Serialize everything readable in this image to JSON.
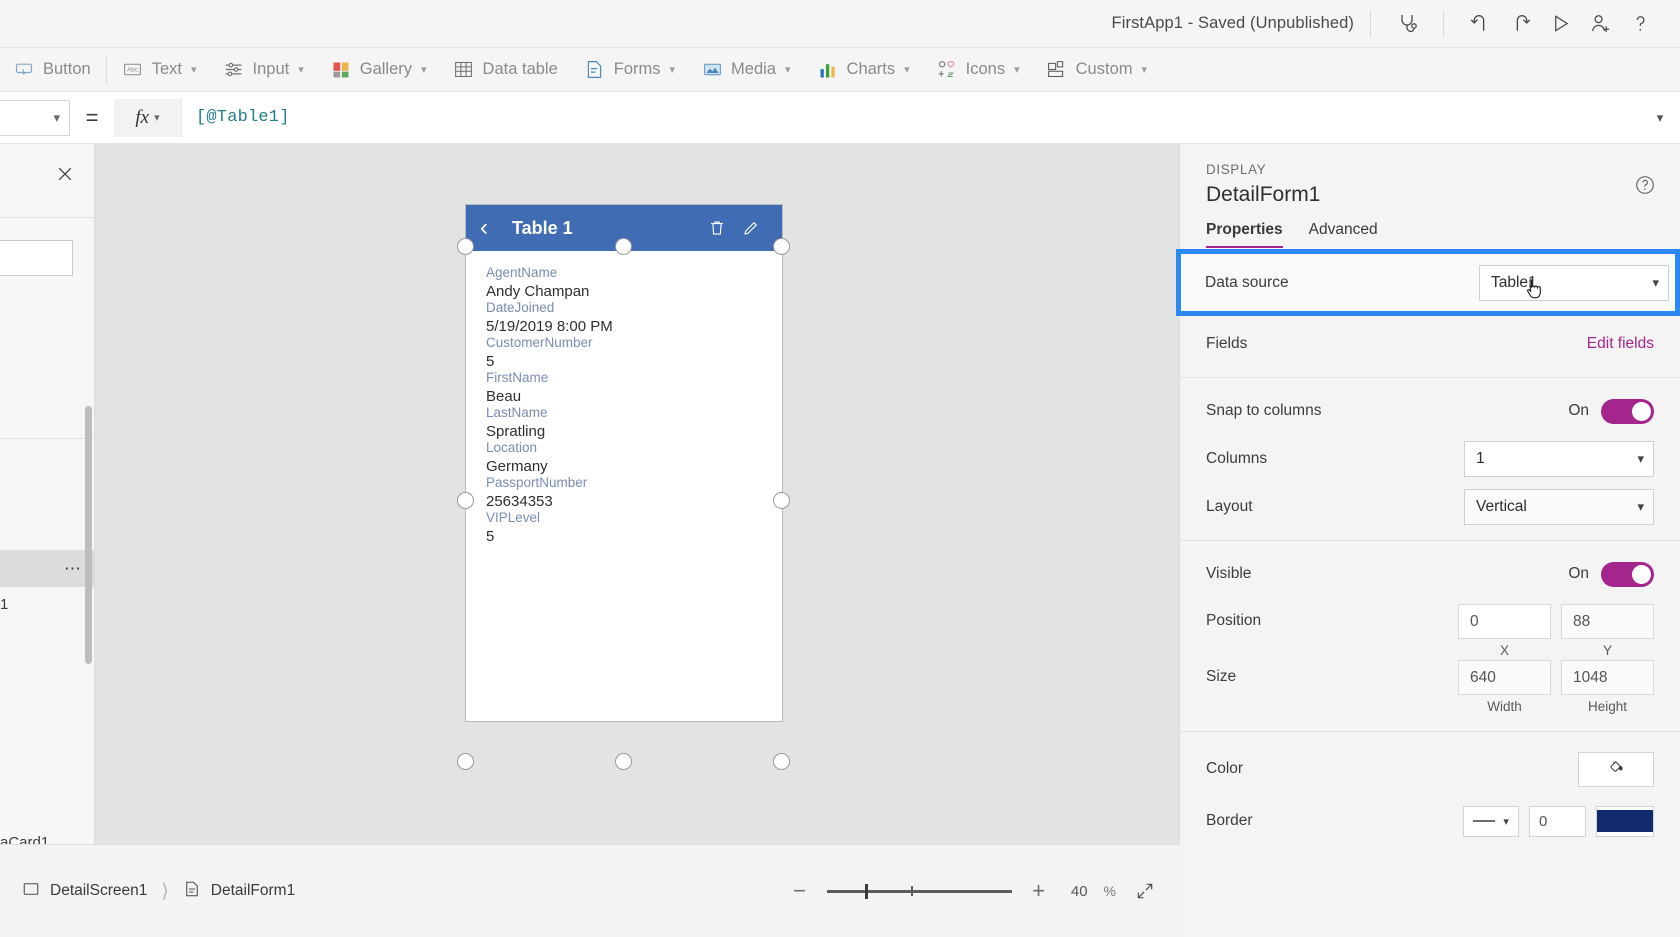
{
  "topbar": {
    "app_title": "FirstApp1 - Saved (Unpublished)",
    "icons": [
      {
        "name": "app-checker-icon",
        "glyph": "stethoscope"
      },
      {
        "name": "undo-icon",
        "glyph": "undo"
      },
      {
        "name": "redo-icon",
        "glyph": "redo"
      },
      {
        "name": "preview-app-icon",
        "glyph": "play"
      },
      {
        "name": "share-icon",
        "glyph": "person-add"
      },
      {
        "name": "help-icon",
        "glyph": "question"
      }
    ]
  },
  "ribbon": {
    "items": [
      {
        "label": "Button",
        "icon": "button-icon",
        "caret": false
      },
      {
        "label": "Text",
        "icon": "text-icon",
        "caret": true
      },
      {
        "label": "Input",
        "icon": "input-icon",
        "caret": true
      },
      {
        "label": "Gallery",
        "icon": "gallery-icon",
        "caret": true
      },
      {
        "label": "Data table",
        "icon": "data-table-icon",
        "caret": false
      },
      {
        "label": "Forms",
        "icon": "forms-icon",
        "caret": true
      },
      {
        "label": "Media",
        "icon": "media-icon",
        "caret": true
      },
      {
        "label": "Charts",
        "icon": "charts-icon",
        "caret": true
      },
      {
        "label": "Icons",
        "icon": "icons-icon",
        "caret": true
      },
      {
        "label": "Custom",
        "icon": "custom-icon",
        "caret": true
      }
    ]
  },
  "formula_bar": {
    "property_value": "",
    "equals": "=",
    "fx_label": "fx",
    "formula": "[@Table1]"
  },
  "canvas": {
    "phone_header": {
      "title": "Table 1",
      "back_icon": "chevron-left-icon",
      "delete_icon": "trash-icon",
      "edit_icon": "pencil-icon"
    },
    "fields": [
      {
        "label": "AgentName",
        "value": "Andy Champan"
      },
      {
        "label": "DateJoined",
        "value": "5/19/2019 8:00 PM"
      },
      {
        "label": "CustomerNumber",
        "value": "5"
      },
      {
        "label": "FirstName",
        "value": "Beau"
      },
      {
        "label": "LastName",
        "value": "Spratling"
      },
      {
        "label": "Location",
        "value": "Germany"
      },
      {
        "label": "PassportNumber",
        "value": "25634353"
      },
      {
        "label": "VIPLevel",
        "value": "5"
      }
    ]
  },
  "properties_panel": {
    "kicker": "DISPLAY",
    "name": "DetailForm1",
    "help_icon": "help-circle-icon",
    "tabs": [
      {
        "label": "Properties",
        "active": true
      },
      {
        "label": "Advanced",
        "active": false
      }
    ],
    "data_source": {
      "label": "Data source",
      "value": "Table1",
      "highlighted": true
    },
    "fields": {
      "label": "Fields",
      "action": "Edit fields"
    },
    "snap_to_columns": {
      "label": "Snap to columns",
      "state": "On"
    },
    "columns": {
      "label": "Columns",
      "value": "1"
    },
    "layout": {
      "label": "Layout",
      "value": "Vertical"
    },
    "visible": {
      "label": "Visible",
      "state": "On"
    },
    "position": {
      "label": "Position",
      "x": "0",
      "y": "88",
      "x_caption": "X",
      "y_caption": "Y"
    },
    "size": {
      "label": "Size",
      "width": "640",
      "height": "1048",
      "width_caption": "Width",
      "height_caption": "Height"
    },
    "color": {
      "label": "Color",
      "icon": "fill-bucket-icon"
    },
    "border": {
      "label": "Border",
      "style": "solid",
      "width": "0",
      "color_hex": "#12296b"
    },
    "accent_hex": "#a4268c",
    "highlight_hex": "#2b88f0"
  },
  "bottom_bar": {
    "breadcrumbs": [
      {
        "label": "DetailScreen1",
        "icon": "screen-icon"
      },
      {
        "label": "DetailForm1",
        "icon": "form-icon"
      }
    ],
    "zoom": {
      "minus": "−",
      "plus": "+",
      "value": "40",
      "unit": "%",
      "fit_icon": "fit-to-screen-icon"
    }
  },
  "left_panel": {
    "close_icon": "close-icon",
    "overflow_icon": "more-options-icon",
    "partial_labels": {
      "row_a": "1",
      "row_b": "aCard1",
      "overflow": "⋯"
    }
  }
}
